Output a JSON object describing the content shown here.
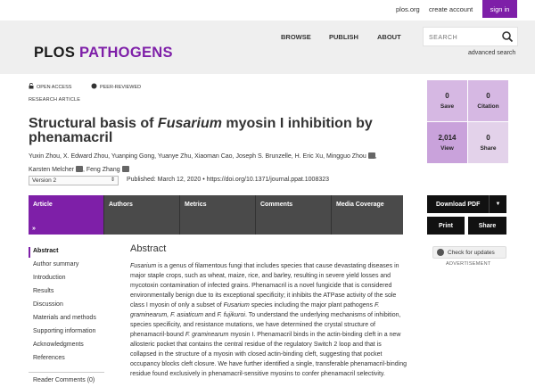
{
  "topbar": {
    "plos_org": "plos.org",
    "create_account": "create account",
    "sign_in": "sign in"
  },
  "header": {
    "logo_plos": "PLOS",
    "logo_pathogens": "PATHOGENS",
    "nav": [
      "BROWSE",
      "PUBLISH",
      "ABOUT"
    ],
    "search_placeholder": "SEARCH",
    "advanced_search": "advanced search"
  },
  "article": {
    "open_access": "OPEN ACCESS",
    "peer_reviewed": "PEER-REVIEWED",
    "type": "RESEARCH ARTICLE",
    "title_part1": "Structural basis of ",
    "title_italic": "Fusarium",
    "title_part2": " myosin I inhibition by phenamacril",
    "authors_line1": "Yuxin Zhou, X. Edward Zhou, Yuanping Gong, Yuanye Zhu, Xiaoman Cao, Joseph S. Brunzelle, H. Eric Xu, Mingguo Zhou",
    "authors_line2a": "Karsten Melcher",
    "authors_line2b": "Feng Zhang",
    "version": "Version 2",
    "published": "Published: March 12, 2020",
    "doi": "https://doi.org/10.1371/journal.ppat.1008323"
  },
  "tabs": [
    "Article",
    "Authors",
    "Metrics",
    "Comments",
    "Media Coverage"
  ],
  "metrics": [
    {
      "num": "0",
      "label": "Save",
      "color": "#d6b8e3"
    },
    {
      "num": "0",
      "label": "Citation",
      "color": "#d6b8e3"
    },
    {
      "num": "2,014",
      "label": "View",
      "color": "#c9a2db"
    },
    {
      "num": "0",
      "label": "Share",
      "color": "#e3d2ea"
    }
  ],
  "actions": {
    "download_pdf": "Download PDF",
    "print": "Print",
    "share": "Share",
    "check_updates": "Check for updates",
    "advertisement": "ADVERTISEMENT"
  },
  "sidenav": {
    "items": [
      "Abstract",
      "Author summary",
      "Introduction",
      "Results",
      "Discussion",
      "Materials and methods",
      "Supporting information",
      "Acknowledgments",
      "References"
    ],
    "reader_comments": "Reader Comments (0)"
  },
  "abstract": {
    "heading": "Abstract",
    "s1_italic": "Fusarium",
    "s1": " is a genus of filamentous fungi that includes species that cause devastating diseases in major staple crops, such as wheat, maize, rice, and barley, resulting in severe yield losses and mycotoxin contamination of infected grains. Phenamacril is a novel fungicide that is considered environmentally benign due to its exceptional specificity; it inhibits the ATPase activity of the sole class I myosin of only a subset of ",
    "s2_italic": "Fusarium",
    "s2": " species including the major plant pathogens ",
    "s3_italic": "F. graminearum, F. asiaticum",
    "s3": " and ",
    "s4_italic": "F. fujikuroi",
    "s4": ". To understand the underlying mechanisms of inhibition, species specificity, and resistance mutations, we have determined the crystal structure of phenamacril-bound ",
    "s5_italic": "F. graminearum",
    "s5": " myosin I. Phenamacril binds in the actin-binding cleft in a new allosteric pocket that contains the central residue of the regulatory Switch 2 loop and that is collapsed in the structure of a myosin with closed actin-binding cleft, suggesting that pocket occupancy blocks cleft closure. We have further identified a single, transferable phenamacril-binding residue found exclusively in phenamacril-sensitive myosins to confer phenamacril selectivity."
  }
}
